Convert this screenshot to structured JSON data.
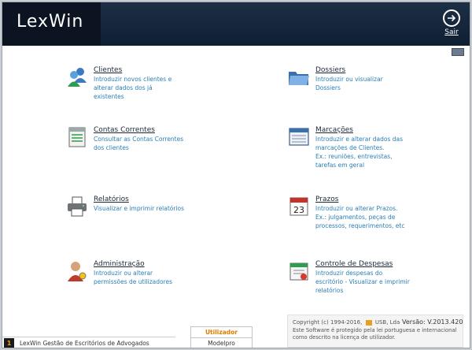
{
  "app": {
    "name": "LexWin"
  },
  "header": {
    "exit_label": "Sair"
  },
  "menu": [
    {
      "title": "Clientes",
      "desc1": "Introduzir novos clientes e",
      "desc2": "alterar dados dos já",
      "desc3": "existentes",
      "icon": "users-icon"
    },
    {
      "title": "Dossiers",
      "desc1": "Introduzir ou visualizar",
      "desc2": "Dossiers",
      "desc3": "",
      "icon": "folder-icon"
    },
    {
      "title": "Contas Correntes",
      "desc1": "Consultar as Contas Correntes",
      "desc2": "dos clientes",
      "desc3": "",
      "icon": "ledger-icon"
    },
    {
      "title": "Marcações",
      "desc1": "Introduzir e alterar dados das",
      "desc2": "marcações de Clientes.",
      "desc3": "Ex.: reuniões, entrevistas,",
      "desc4": "tarefas em geral",
      "icon": "schedule-icon"
    },
    {
      "title": "Relatórios",
      "desc1": "Visualizar e imprimir relatórios",
      "desc2": "",
      "desc3": "",
      "icon": "printer-icon"
    },
    {
      "title": "Prazos",
      "desc1": "Introduzir ou alterar Prazos.",
      "desc2": "Ex.: julgamentos, peças de",
      "desc3": "processos, requerimentos, etc",
      "icon": "calendar-icon"
    },
    {
      "title": "Administração",
      "desc1": "Introduzir ou alterar",
      "desc2": "permissões de utilizadores",
      "desc3": "",
      "icon": "admin-icon"
    },
    {
      "title": "Controle de Despesas",
      "desc1": "Introduzir despesas do",
      "desc2": "escritório - Visualizar e imprimir",
      "desc3": "relatórios",
      "icon": "expenses-icon"
    }
  ],
  "calendar_day": "23",
  "footer": {
    "copyright": "Copyright (c) 1994-2016,",
    "company": "USB, Lda",
    "version": "Versão: V.2013.420",
    "line2": "Este Software é protegido pela lei portuguesa e internacional",
    "line3": "como descrito na licença de utilizador.",
    "status_icon_text": "1",
    "status_text": "LexWin Gestão de Escritórios de Advogados",
    "user_title": "Utilizador",
    "user_name": "Modelpro"
  }
}
